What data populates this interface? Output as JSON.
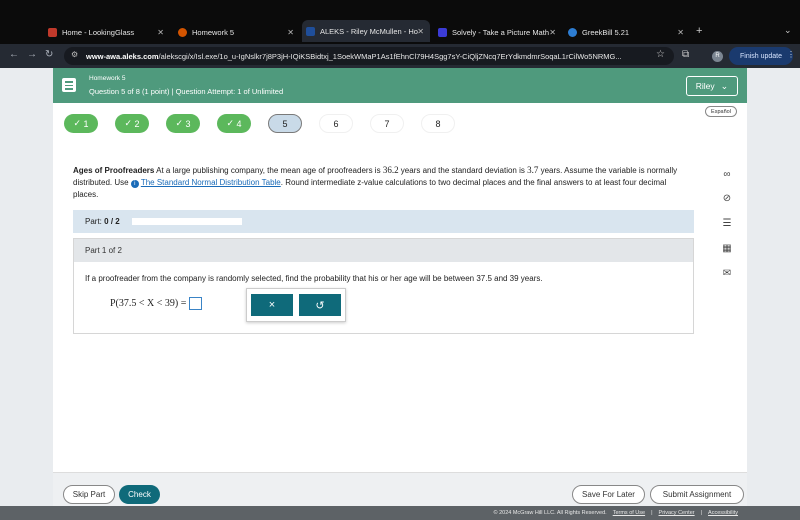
{
  "browser": {
    "tabs": [
      {
        "title": "Home - LookingGlass",
        "icon_color": "#c0392b"
      },
      {
        "title": "Homework 5",
        "icon_color": "#d35400"
      },
      {
        "title": "ALEKS - Riley McMullen - Ho",
        "icon_color": "#1f4e9a"
      },
      {
        "title": "Solvely - Take a Picture Math",
        "icon_color": "#3b3bd6"
      },
      {
        "title": "GreekBill 5.21",
        "icon_color": "#2d7dd2"
      }
    ],
    "url_domain": "www-awa.aleks.com",
    "url_path": "/alekscgi/x/Isl.exe/1o_u-IgNslkr7j8P3jH-IQiKSBidtxj_1SoekWMaP1As1fEhnCl79H4Sgg7sY-CiQljZNcq7ErYdkmdmrSoqaL1rCilWo5NRMG...",
    "profile_initial": "R",
    "finish_update": "Finish update"
  },
  "header": {
    "assignment": "Homework 5",
    "question_info": "Question 5 of 8 (1 point)  |  Question Attempt: 1 of Unlimited",
    "user": "Riley"
  },
  "espanol": "Español",
  "question_nav": [
    {
      "label": "1",
      "state": "done"
    },
    {
      "label": "2",
      "state": "done"
    },
    {
      "label": "3",
      "state": "done"
    },
    {
      "label": "4",
      "state": "done"
    },
    {
      "label": "5",
      "state": "current"
    },
    {
      "label": "6",
      "state": "todo"
    },
    {
      "label": "7",
      "state": "todo"
    },
    {
      "label": "8",
      "state": "todo"
    }
  ],
  "problem": {
    "title": "Ages of Proofreaders",
    "intro": "At a large publishing company, the mean age of proofreaders is",
    "mean": "36.2",
    "mid": "years and the standard deviation is",
    "sd": "3.7",
    "after_sd": "years. Assume the variable is normally distributed. Use",
    "link": "The Standard Normal Distribution Table",
    "ending": ". Round intermediate z-value calculations to two decimal places and the final answers to at least four decimal places."
  },
  "part_bar": {
    "label": "Part:",
    "value": "0 / 2"
  },
  "part": {
    "header": "Part 1 of 2",
    "question": "If a proofreader from the company is randomly selected, find the probability that his or her age will be between 37.5 and 39 years.",
    "equation": "P(37.5 < X < 39) ="
  },
  "tools": {
    "clear": "×",
    "undo": "↺"
  },
  "footer": {
    "skip": "Skip Part",
    "check": "Check",
    "save": "Save For Later",
    "submit": "Submit Assignment"
  },
  "copyright": {
    "text": "© 2024 McGraw Hill LLC. All Rights Reserved.",
    "terms": "Terms of Use",
    "privacy": "Privacy Center",
    "access": "Accessibility"
  }
}
